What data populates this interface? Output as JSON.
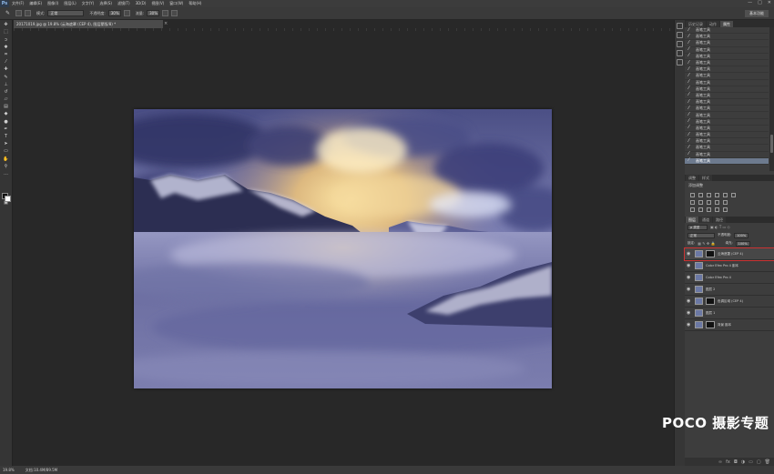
{
  "app": {
    "logo": "Ps"
  },
  "menubar": {
    "items": [
      "文件(F)",
      "编辑(E)",
      "图像(I)",
      "图层(L)",
      "文字(Y)",
      "选择(S)",
      "滤镜(T)",
      "3D(D)",
      "视图(V)",
      "窗口(W)",
      "帮助(H)"
    ],
    "window_controls": [
      "—",
      "□",
      "✕"
    ]
  },
  "options": {
    "mode_label": "模式:",
    "mode_value": "正常",
    "opacity_label": "不透明度:",
    "opacity_value": "30%",
    "flow_label": "流量:",
    "flow_value": "30%",
    "workspace": "基本功能"
  },
  "document": {
    "tab_title": "20171019.jpg @ 19.8% (云海遮罩 (CEP 4), 图层蒙版/8) *",
    "zoom": "19.8%",
    "status": "文档:10.4M/89.5M"
  },
  "history": {
    "tabs": [
      "历史记录",
      "动作",
      "属性"
    ],
    "rows": [
      "画笔工具",
      "画笔工具",
      "画笔工具",
      "画笔工具",
      "画笔工具",
      "画笔工具",
      "画笔工具",
      "画笔工具",
      "画笔工具",
      "画笔工具",
      "画笔工具",
      "画笔工具",
      "画笔工具",
      "画笔工具",
      "画笔工具",
      "画笔工具",
      "画笔工具",
      "画笔工具",
      "画笔工具",
      "画笔工具",
      "画笔工具"
    ]
  },
  "adjustments": {
    "tabs": [
      "调整",
      "样式"
    ],
    "title": "添加调整"
  },
  "layers": {
    "tabs": [
      "图层",
      "通道",
      "路径"
    ],
    "kind": "ρ 类型",
    "blend": "正常",
    "opacity_label": "不透明度:",
    "opacity_value": "100%",
    "lock_label": "锁定:",
    "fill_label": "填充:",
    "fill_value": "100%",
    "items": [
      {
        "name": "云海遮罩 (CEP 4)",
        "selected": true
      },
      {
        "name": "Color Efex Pro 4 副本",
        "selected": false
      },
      {
        "name": "Color Efex Pro 4",
        "selected": false
      },
      {
        "name": "图层 2",
        "selected": false
      },
      {
        "name": "色调区域 (CEP 4)",
        "selected": false
      },
      {
        "name": "图层 1",
        "selected": false
      },
      {
        "name": "背景 副本",
        "selected": false
      }
    ]
  },
  "watermark": "POCO 摄影专题",
  "colors": {
    "accent": "#6d7a8e",
    "selection_outline": "#cc3333"
  }
}
